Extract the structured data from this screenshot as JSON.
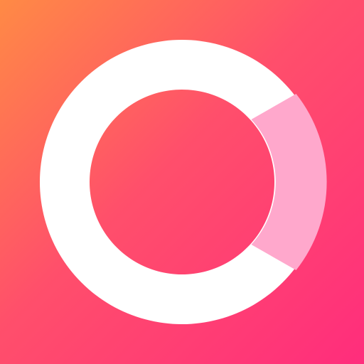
{
  "icon": {
    "name": "ring-logo-icon",
    "shape": "ring with highlighted arc segment on the right",
    "colors": {
      "gradient_start": "#FF8A45",
      "gradient_mid": "#FF4F6B",
      "gradient_end": "#FF2D7C",
      "ring": "#FFFFFF",
      "highlight_segment": "#FFA8CC"
    }
  }
}
